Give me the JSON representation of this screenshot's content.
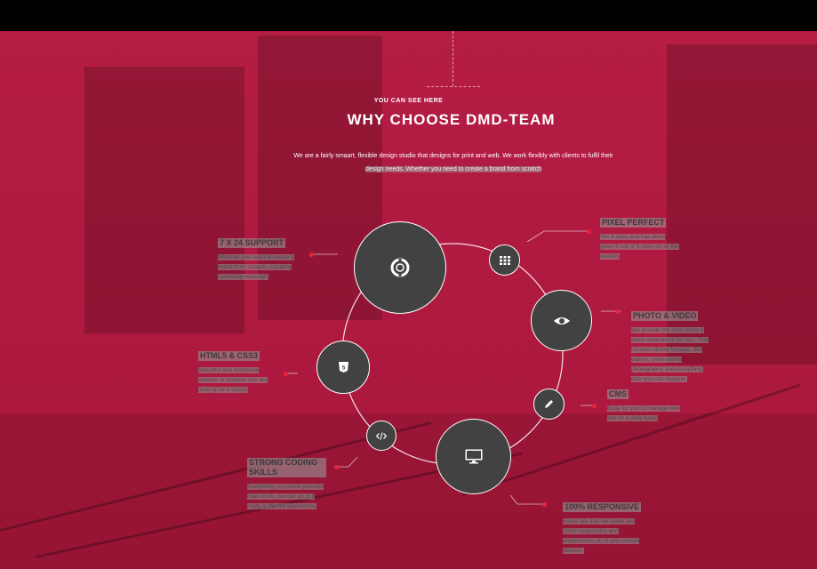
{
  "header": {
    "kicker": "YOU CAN SEE HERE",
    "title": "WHY CHOOSE DMD-TEAM"
  },
  "intro": {
    "line1": "We are a fairly smaart, flexible design studio that designs for print and web. We work flexibly with clients to fulfil their",
    "line2": "design needs. Whether you need to create a brand from scratch"
  },
  "features": {
    "support": {
      "title": "7 X 24 SUPPORT",
      "lines": [
        "Whether you need to create a",
        "brand from scratch, including",
        "marketing materials"
      ]
    },
    "pixel": {
      "title": "PIXEL PERFECT",
      "lines": [
        "Yes it does and has been",
        "given 5 out of 5 stars on all the",
        "reviews"
      ]
    },
    "photo": {
      "title": "PHOTO & VIDEO",
      "lines": [
        "We provide the best photo &",
        "video experience for you. That",
        "includes drone footage, 360",
        "videos, professional",
        "photography and everything",
        "else you can imagine."
      ]
    },
    "html": {
      "title": "HTML5 & CSS3",
      "lines": [
        "Beautiful and functional",
        "website or whether you are",
        "looking for a design"
      ]
    },
    "cms": {
      "title": "CMS",
      "lines": [
        "Easy for you to manage web",
        "site on a daily basis"
      ]
    },
    "coding": {
      "title": "STRONG CODING SKILLS",
      "lines": [
        "Everything you could possible",
        "need to do, we can do it! It",
        "really is the full experience."
      ]
    },
    "responsive": {
      "title": "100% RESPONSIVE",
      "lines": [
        "Every site that we made are",
        "100% responsive and",
        "prepared for all of your mobile",
        "devices."
      ]
    }
  },
  "icons": {
    "support": "lifebuoy-icon",
    "grid": "grid-icon",
    "eye": "eye-icon",
    "html5": "html5-icon",
    "pencil": "pencil-icon",
    "code": "code-icon",
    "monitor": "monitor-icon"
  },
  "colors": {
    "background": "#b01a40",
    "node": "#424242",
    "dot": "#e8243f",
    "topbar": "#000000"
  }
}
